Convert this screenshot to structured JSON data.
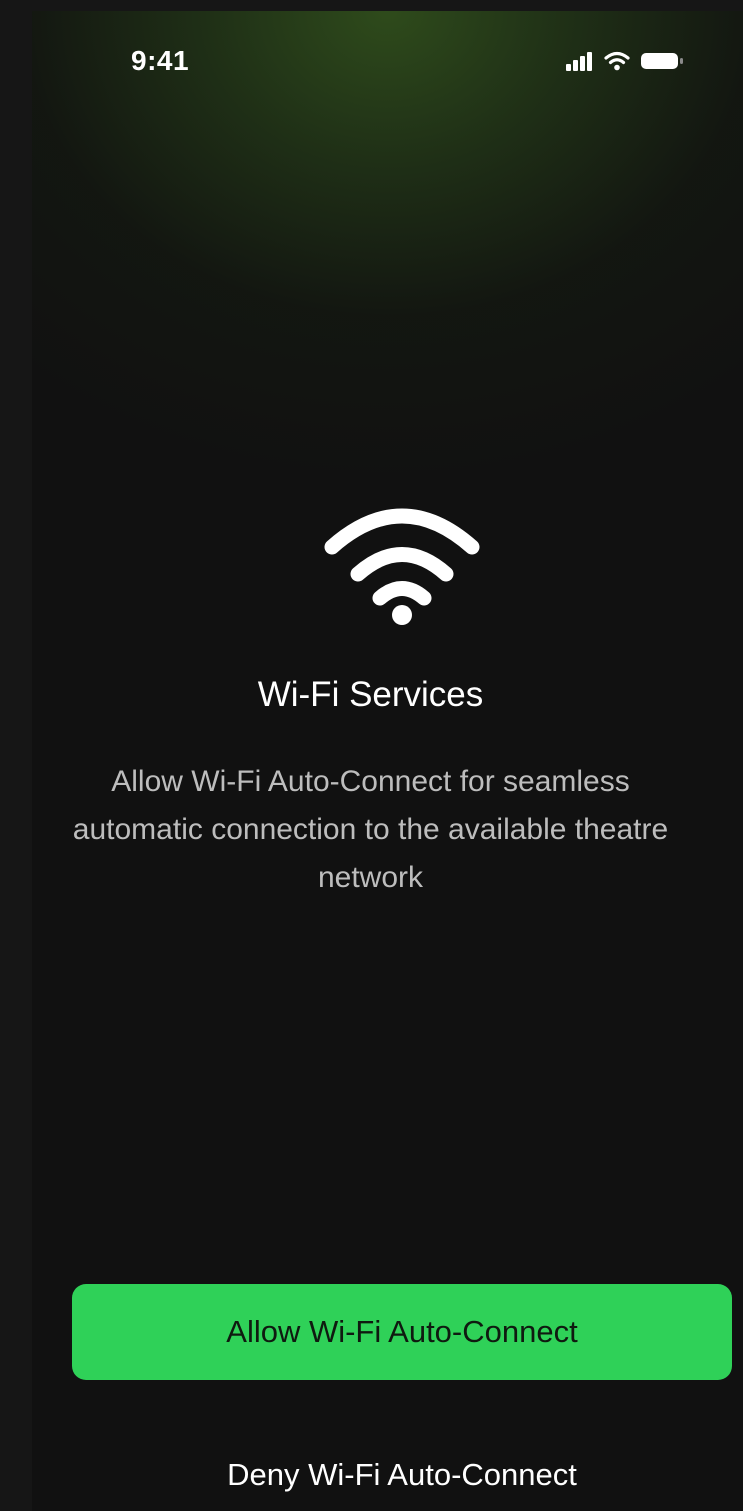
{
  "status_bar": {
    "time": "9:41",
    "icons": [
      "cellular-signal-icon",
      "wifi-icon",
      "battery-icon"
    ]
  },
  "hero": {
    "icon": "wifi-icon",
    "title": "Wi-Fi Services",
    "description": "Allow Wi-Fi Auto-Connect for seamless automatic connection to the available theatre network"
  },
  "actions": {
    "allow_label": "Allow Wi-Fi Auto-Connect",
    "deny_label": "Deny Wi-Fi Auto-Connect"
  },
  "colors": {
    "accent": "#2fd158",
    "background": "#111111",
    "gradient_tint": "#304e1c"
  }
}
